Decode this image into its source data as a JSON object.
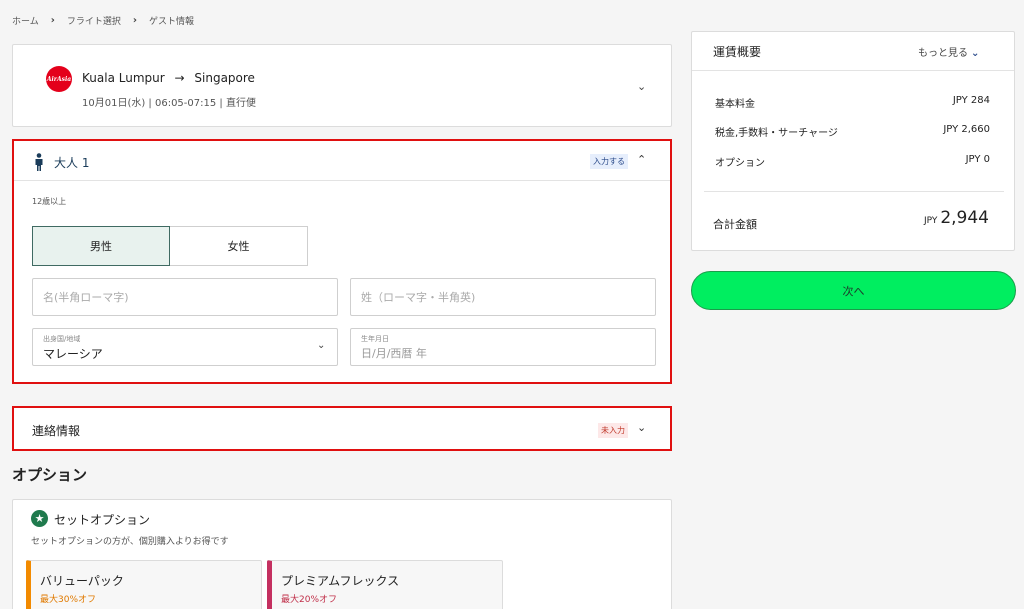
{
  "breadcrumb": [
    "ホーム",
    "フライト選択",
    "ゲスト情報"
  ],
  "flight": {
    "airline_logo_text": "AirAsia",
    "origin": "Kuala Lumpur",
    "arrow": "→",
    "destination": "Singapore",
    "details": "10月01日(水)  |  06:05-07:15  |  直行便"
  },
  "guest": {
    "title": "大人 1",
    "status": "入力する",
    "age_note": "12歳以上",
    "gender": {
      "male": "男性",
      "female": "女性",
      "selected": "male"
    },
    "given_name_placeholder": "名(半角ローマ字)",
    "family_name_placeholder": "姓（ローマ字・半角英)",
    "country_label": "出身国/地域",
    "country_value": "マレーシア",
    "dob_label": "生年月日",
    "dob_placeholder": "日/月/西暦 年"
  },
  "contact": {
    "title": "連絡情報",
    "status": "未入力"
  },
  "options": {
    "heading": "オプション",
    "set_title": "セットオプション",
    "set_desc": "セットオプションの方が、個別購入よりお得です",
    "packs": [
      {
        "name": "バリューパック",
        "discount": "最大30%オフ"
      },
      {
        "name": "プレミアムフレックス",
        "discount": "最大20%オフ"
      }
    ]
  },
  "fare": {
    "title": "運賃概要",
    "more": "もっと見る",
    "rows": [
      {
        "label": "基本料金",
        "amount": "JPY 284"
      },
      {
        "label": "税金,手数料・サーチャージ",
        "amount": "JPY 2,660"
      },
      {
        "label": "オプション",
        "amount": "JPY 0"
      }
    ],
    "total_label": "合計金額",
    "total_currency": "JPY",
    "total_value": "2,944"
  },
  "next_label": "次へ",
  "colors": {
    "accent_green": "#00ee60",
    "highlight_red": "#e01010",
    "airasia_red": "#e4001b"
  }
}
